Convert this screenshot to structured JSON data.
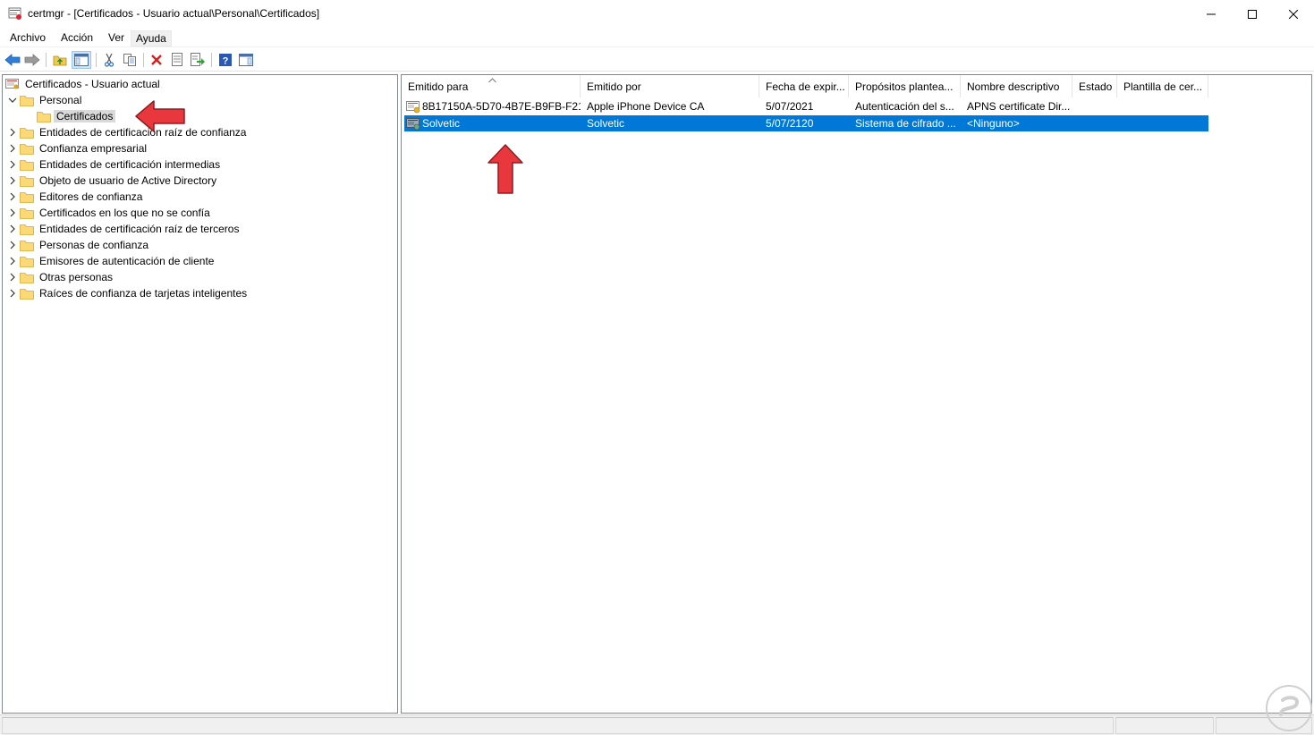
{
  "window": {
    "title": "certmgr - [Certificados - Usuario actual\\Personal\\Certificados]"
  },
  "menu": {
    "items": [
      "Archivo",
      "Acción",
      "Ver",
      "Ayuda"
    ]
  },
  "toolbar": {
    "buttons": [
      "back-icon",
      "forward-icon",
      "up-folder-icon",
      "show-hide-console-tree-icon",
      "cut-icon",
      "copy-icon",
      "delete-icon",
      "properties-icon",
      "export-list-icon",
      "help-icon",
      "show-action-pane-icon"
    ]
  },
  "tree": {
    "root": "Certificados - Usuario actual",
    "personal": "Personal",
    "certificados": "Certificados",
    "items": [
      "Entidades de certificación raíz de confianza",
      "Confianza empresarial",
      "Entidades de certificación intermedias",
      "Objeto de usuario de Active Directory",
      "Editores de confianza",
      "Certificados en los que no se confía",
      "Entidades de certificación raíz de terceros",
      "Personas de confianza",
      "Emisores de autenticación de cliente",
      "Otras personas",
      "Raíces de confianza de tarjetas inteligentes"
    ]
  },
  "list": {
    "columns": [
      "Emitido para",
      "Emitido por",
      "Fecha de expir...",
      "Propósitos plantea...",
      "Nombre descriptivo",
      "Estado",
      "Plantilla de cer..."
    ],
    "rows": [
      {
        "issued_to": "8B17150A-5D70-4B7E-B9FB-F21...",
        "issued_by": "Apple iPhone Device CA",
        "expiry": "5/07/2021",
        "purposes": "Autenticación del s...",
        "friendly_name": "APNS certificate Dir...",
        "status": "",
        "template": "",
        "selected": false
      },
      {
        "issued_to": "Solvetic",
        "issued_by": "Solvetic",
        "expiry": "5/07/2120",
        "purposes": "Sistema de cifrado ...",
        "friendly_name": "<Ninguno>",
        "status": "",
        "template": "",
        "selected": true
      }
    ]
  },
  "colors": {
    "selection": "#0078d7",
    "annotation_arrow": "#e8383d"
  }
}
